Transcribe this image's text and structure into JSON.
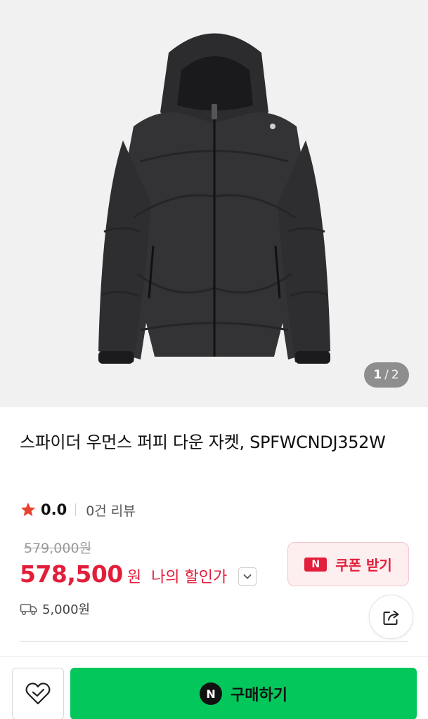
{
  "gallery": {
    "image_alt": "black hooded down puffer jacket",
    "current": "1",
    "separator": "/",
    "total": "2"
  },
  "product": {
    "title": "스파이더 우먼스 퍼피 다운 자켓, SPFWCNDJ352W"
  },
  "rating": {
    "score": "0.0",
    "reviews": "0건 리뷰",
    "star_color": "#e8412c"
  },
  "pricing": {
    "original_price": "579,000원",
    "sale_price": "578,500",
    "currency": "원",
    "my_price_label": "나의 할인가",
    "accent_color": "#e31e3a"
  },
  "coupon": {
    "badge": "N",
    "label": "쿠폰 받기"
  },
  "shipping": {
    "fee": "5,000원"
  },
  "actions": {
    "buy_badge": "N",
    "buy_label": "구매하기",
    "buy_color": "#03c75a"
  },
  "icons": {
    "star": "star-icon",
    "chevron": "chevron-down-icon",
    "truck": "truck-icon",
    "share": "share-icon",
    "wish": "heart-check-icon"
  }
}
